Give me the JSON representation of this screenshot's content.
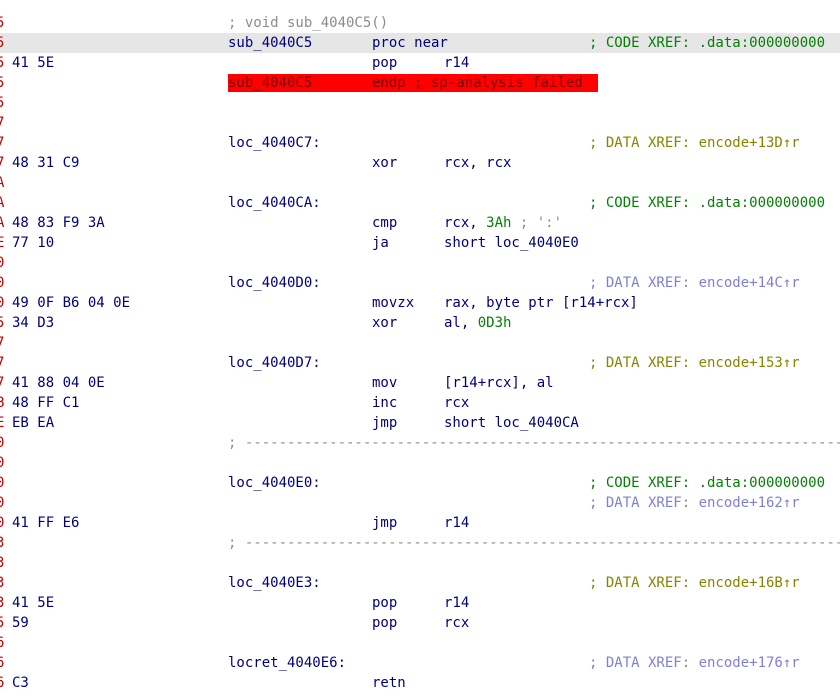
{
  "listing": {
    "prototype_comment": "; void sub_4040C5()",
    "lines": [
      {
        "gutter": "5",
        "bytes": "",
        "label": "sub_4040C5",
        "mnemonic": "proc near",
        "operands": "",
        "comment": "; CODE XREF: .data:000000000",
        "comment_kind": "code",
        "highlight": true
      },
      {
        "gutter": "5",
        "bytes": "41 5E",
        "label": "",
        "mnemonic": "pop",
        "operands": "r14",
        "comment": ""
      },
      {
        "gutter": "5",
        "bytes": "",
        "label": "sub_4040C5",
        "mnemonic": "endp ; sp-analysis failed",
        "operands": "",
        "comment": "",
        "error": true
      },
      {
        "gutter": "5",
        "bytes": "",
        "label": "",
        "mnemonic": "",
        "operands": "",
        "comment": ""
      },
      {
        "gutter": "7",
        "bytes": "",
        "label": "",
        "mnemonic": "",
        "operands": "",
        "comment": ""
      },
      {
        "gutter": "7",
        "bytes": "",
        "label": "loc_4040C7:",
        "mnemonic": "",
        "operands": "",
        "comment": "; DATA XREF: encode+13D↑r",
        "comment_kind": "data"
      },
      {
        "gutter": "7",
        "bytes": "48 31 C9",
        "label": "",
        "mnemonic": "xor",
        "operands": "rcx, rcx",
        "comment": ""
      },
      {
        "gutter": "A",
        "bytes": "",
        "label": "",
        "mnemonic": "",
        "operands": "",
        "comment": ""
      },
      {
        "gutter": "A",
        "bytes": "",
        "label": "loc_4040CA:",
        "mnemonic": "",
        "operands": "",
        "comment": "; CODE XREF: .data:000000000",
        "comment_kind": "code"
      },
      {
        "gutter": "A",
        "bytes": "48 83 F9 3A",
        "label": "",
        "mnemonic": "cmp",
        "operands": "rcx, ",
        "operands_num": "3Ah",
        "operands_comment": " ; ':'",
        "comment": ""
      },
      {
        "gutter": "E",
        "bytes": "77 10",
        "label": "",
        "mnemonic": "ja",
        "operands": "short loc_4040E0",
        "comment": ""
      },
      {
        "gutter": "0",
        "bytes": "",
        "label": "",
        "mnemonic": "",
        "operands": "",
        "comment": ""
      },
      {
        "gutter": "0",
        "bytes": "",
        "label": "loc_4040D0:",
        "mnemonic": "",
        "operands": "",
        "comment": "; DATA XREF: encode+14C↑r",
        "comment_kind": "data-light"
      },
      {
        "gutter": "0",
        "bytes": "49 0F B6 04 0E",
        "label": "",
        "mnemonic": "movzx",
        "operands": "rax, byte ptr [r14+rcx]",
        "comment": ""
      },
      {
        "gutter": "5",
        "bytes": "34 D3",
        "label": "",
        "mnemonic": "xor",
        "operands": "al, ",
        "operands_num": "0D3h",
        "comment": ""
      },
      {
        "gutter": "7",
        "bytes": "",
        "label": "",
        "mnemonic": "",
        "operands": "",
        "comment": ""
      },
      {
        "gutter": "7",
        "bytes": "",
        "label": "loc_4040D7:",
        "mnemonic": "",
        "operands": "",
        "comment": "; DATA XREF: encode+153↑r",
        "comment_kind": "data"
      },
      {
        "gutter": "7",
        "bytes": "41 88 04 0E",
        "label": "",
        "mnemonic": "mov",
        "operands": "[r14+rcx], al",
        "comment": ""
      },
      {
        "gutter": "B",
        "bytes": "48 FF C1",
        "label": "",
        "mnemonic": "inc",
        "operands": "rcx",
        "comment": ""
      },
      {
        "gutter": "E",
        "bytes": "EB EA",
        "label": "",
        "mnemonic": "jmp",
        "operands": "short loc_4040CA",
        "comment": ""
      },
      {
        "gutter": "0",
        "bytes": "",
        "label": "",
        "separator": true,
        "mnemonic": "",
        "operands": "",
        "comment": ""
      },
      {
        "gutter": "0",
        "bytes": "",
        "label": "",
        "mnemonic": "",
        "operands": "",
        "comment": ""
      },
      {
        "gutter": "0",
        "bytes": "",
        "label": "loc_4040E0:",
        "mnemonic": "",
        "operands": "",
        "comment": "; CODE XREF: .data:000000000",
        "comment_kind": "code"
      },
      {
        "gutter": "0",
        "bytes": "",
        "label": "",
        "mnemonic": "",
        "operands": "",
        "comment": "; DATA XREF: encode+162↑r",
        "comment_kind": "data-light"
      },
      {
        "gutter": "0",
        "bytes": "41 FF E6",
        "label": "",
        "mnemonic": "jmp",
        "operands": "r14",
        "comment": ""
      },
      {
        "gutter": "3",
        "bytes": "",
        "label": "",
        "separator": true,
        "mnemonic": "",
        "operands": "",
        "comment": ""
      },
      {
        "gutter": "3",
        "bytes": "",
        "label": "",
        "mnemonic": "",
        "operands": "",
        "comment": ""
      },
      {
        "gutter": "3",
        "bytes": "",
        "label": "loc_4040E3:",
        "mnemonic": "",
        "operands": "",
        "comment": "; DATA XREF: encode+16B↑r",
        "comment_kind": "data"
      },
      {
        "gutter": "3",
        "bytes": "41 5E",
        "label": "",
        "mnemonic": "pop",
        "operands": "r14",
        "comment": ""
      },
      {
        "gutter": "5",
        "bytes": "59",
        "label": "",
        "mnemonic": "pop",
        "operands": "rcx",
        "comment": ""
      },
      {
        "gutter": "6",
        "bytes": "",
        "label": "",
        "mnemonic": "",
        "operands": "",
        "comment": ""
      },
      {
        "gutter": "6",
        "bytes": "",
        "label": "locret_4040E6:",
        "mnemonic": "",
        "operands": "",
        "comment": "; DATA XREF: encode+176↑r",
        "comment_kind": "data-light"
      },
      {
        "gutter": "6",
        "bytes": "C3",
        "label": "",
        "mnemonic": "retn",
        "operands": "",
        "comment": ""
      }
    ],
    "separator_text": "; ---------------------------------------------------------------------------",
    "colors": {
      "code_text": "#00007f",
      "code_xref": "#067f06",
      "data_xref": "#858500",
      "data_xref_light": "#7f7fd6",
      "address_gutter": "#c00000",
      "error_bg": "#ff0000",
      "highlight_bg": "#e6e6e6"
    }
  }
}
